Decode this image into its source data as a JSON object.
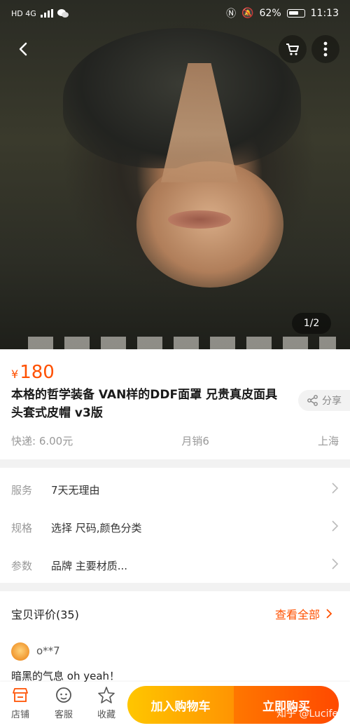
{
  "status_bar": {
    "signal_label": "HD 4G",
    "battery": "62%",
    "time": "11:13"
  },
  "hero": {
    "page_indicator": "1/2"
  },
  "product": {
    "currency_symbol": "¥",
    "price": "180",
    "title": "本格的哲学装备 VAN样的DDF面罩 兄贵真皮面具 头套式皮帽 v3版",
    "share_label": "分享",
    "shipping": "快递: 6.00元",
    "monthly_sales": "月销6",
    "location": "上海"
  },
  "options": [
    {
      "label": "服务",
      "value": "7天无理由"
    },
    {
      "label": "规格",
      "value": "选择 尺码,颜色分类"
    },
    {
      "label": "参数",
      "value": "品牌 主要材质..."
    }
  ],
  "reviews": {
    "heading": "宝贝评价(35)",
    "view_all": "查看全部",
    "user": "o**7",
    "text": "暗黑的气息 oh yeah！"
  },
  "bottom_bar": {
    "store": "店铺",
    "service": "客服",
    "favorite": "收藏",
    "add_to_cart": "加入购物车",
    "buy_now": "立即购买"
  },
  "watermark": "知乎 @Lucifer",
  "colors": {
    "accent": "#ff5000",
    "cart_gradient": [
      "#ffc600",
      "#ff9402"
    ],
    "buy_gradient": [
      "#ff7700",
      "#ff4900"
    ]
  }
}
